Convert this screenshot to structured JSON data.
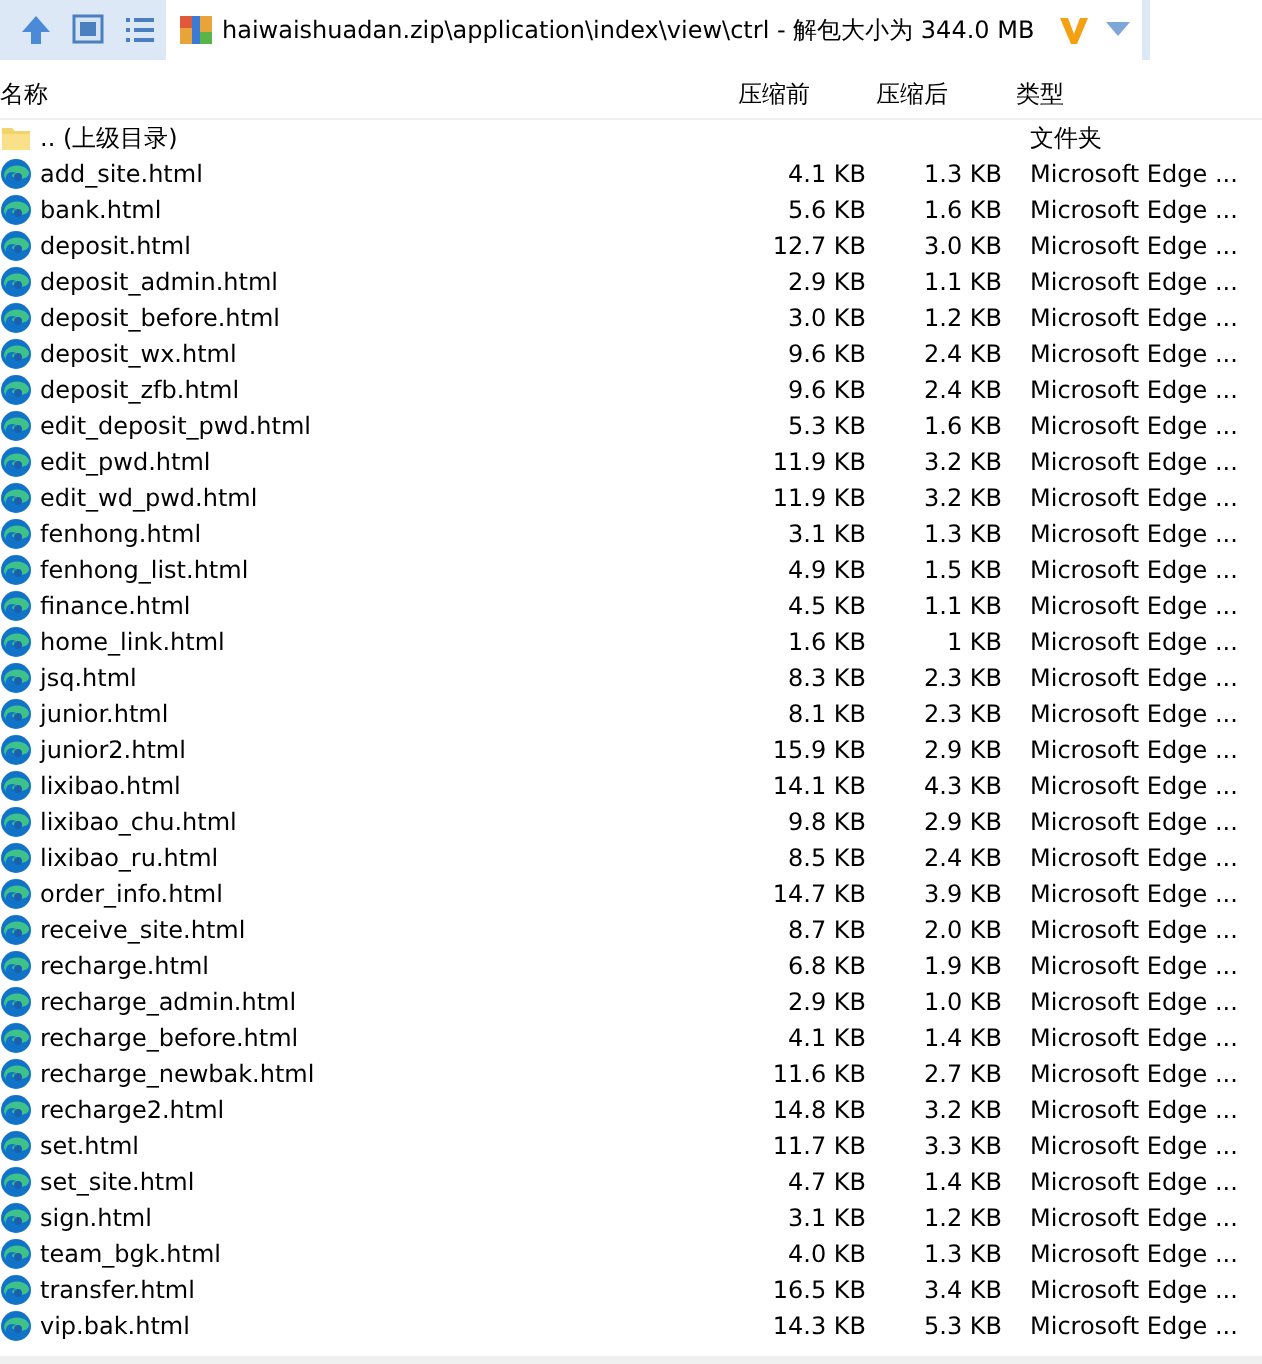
{
  "address_bar": {
    "path": "haiwaishuadan.zip\\application\\index\\view\\ctrl - 解包大小为 344.0 MB"
  },
  "columns": [
    "名称",
    "压缩前",
    "压缩后",
    "类型"
  ],
  "rows": [
    {
      "kind": "folder",
      "name": ".. (上级目录)",
      "size": "",
      "packed": "",
      "type": "文件夹"
    },
    {
      "kind": "file",
      "name": "add_site.html",
      "size": "4.1 KB",
      "packed": "1.3 KB",
      "type": "Microsoft Edge ..."
    },
    {
      "kind": "file",
      "name": "bank.html",
      "size": "5.6 KB",
      "packed": "1.6 KB",
      "type": "Microsoft Edge ..."
    },
    {
      "kind": "file",
      "name": "deposit.html",
      "size": "12.7 KB",
      "packed": "3.0 KB",
      "type": "Microsoft Edge ..."
    },
    {
      "kind": "file",
      "name": "deposit_admin.html",
      "size": "2.9 KB",
      "packed": "1.1 KB",
      "type": "Microsoft Edge ..."
    },
    {
      "kind": "file",
      "name": "deposit_before.html",
      "size": "3.0 KB",
      "packed": "1.2 KB",
      "type": "Microsoft Edge ..."
    },
    {
      "kind": "file",
      "name": "deposit_wx.html",
      "size": "9.6 KB",
      "packed": "2.4 KB",
      "type": "Microsoft Edge ..."
    },
    {
      "kind": "file",
      "name": "deposit_zfb.html",
      "size": "9.6 KB",
      "packed": "2.4 KB",
      "type": "Microsoft Edge ..."
    },
    {
      "kind": "file",
      "name": "edit_deposit_pwd.html",
      "size": "5.3 KB",
      "packed": "1.6 KB",
      "type": "Microsoft Edge ..."
    },
    {
      "kind": "file",
      "name": "edit_pwd.html",
      "size": "11.9 KB",
      "packed": "3.2 KB",
      "type": "Microsoft Edge ..."
    },
    {
      "kind": "file",
      "name": "edit_wd_pwd.html",
      "size": "11.9 KB",
      "packed": "3.2 KB",
      "type": "Microsoft Edge ..."
    },
    {
      "kind": "file",
      "name": "fenhong.html",
      "size": "3.1 KB",
      "packed": "1.3 KB",
      "type": "Microsoft Edge ..."
    },
    {
      "kind": "file",
      "name": "fenhong_list.html",
      "size": "4.9 KB",
      "packed": "1.5 KB",
      "type": "Microsoft Edge ..."
    },
    {
      "kind": "file",
      "name": "finance.html",
      "size": "4.5 KB",
      "packed": "1.1 KB",
      "type": "Microsoft Edge ..."
    },
    {
      "kind": "file",
      "name": "home_link.html",
      "size": "1.6 KB",
      "packed": "1 KB",
      "type": "Microsoft Edge ..."
    },
    {
      "kind": "file",
      "name": "jsq.html",
      "size": "8.3 KB",
      "packed": "2.3 KB",
      "type": "Microsoft Edge ..."
    },
    {
      "kind": "file",
      "name": "junior.html",
      "size": "8.1 KB",
      "packed": "2.3 KB",
      "type": "Microsoft Edge ..."
    },
    {
      "kind": "file",
      "name": "junior2.html",
      "size": "15.9 KB",
      "packed": "2.9 KB",
      "type": "Microsoft Edge ..."
    },
    {
      "kind": "file",
      "name": "lixibao.html",
      "size": "14.1 KB",
      "packed": "4.3 KB",
      "type": "Microsoft Edge ..."
    },
    {
      "kind": "file",
      "name": "lixibao_chu.html",
      "size": "9.8 KB",
      "packed": "2.9 KB",
      "type": "Microsoft Edge ..."
    },
    {
      "kind": "file",
      "name": "lixibao_ru.html",
      "size": "8.5 KB",
      "packed": "2.4 KB",
      "type": "Microsoft Edge ..."
    },
    {
      "kind": "file",
      "name": "order_info.html",
      "size": "14.7 KB",
      "packed": "3.9 KB",
      "type": "Microsoft Edge ..."
    },
    {
      "kind": "file",
      "name": "receive_site.html",
      "size": "8.7 KB",
      "packed": "2.0 KB",
      "type": "Microsoft Edge ..."
    },
    {
      "kind": "file",
      "name": "recharge.html",
      "size": "6.8 KB",
      "packed": "1.9 KB",
      "type": "Microsoft Edge ..."
    },
    {
      "kind": "file",
      "name": "recharge_admin.html",
      "size": "2.9 KB",
      "packed": "1.0 KB",
      "type": "Microsoft Edge ..."
    },
    {
      "kind": "file",
      "name": "recharge_before.html",
      "size": "4.1 KB",
      "packed": "1.4 KB",
      "type": "Microsoft Edge ..."
    },
    {
      "kind": "file",
      "name": "recharge_newbak.html",
      "size": "11.6 KB",
      "packed": "2.7 KB",
      "type": "Microsoft Edge ..."
    },
    {
      "kind": "file",
      "name": "recharge2.html",
      "size": "14.8 KB",
      "packed": "3.2 KB",
      "type": "Microsoft Edge ..."
    },
    {
      "kind": "file",
      "name": "set.html",
      "size": "11.7 KB",
      "packed": "3.3 KB",
      "type": "Microsoft Edge ..."
    },
    {
      "kind": "file",
      "name": "set_site.html",
      "size": "4.7 KB",
      "packed": "1.4 KB",
      "type": "Microsoft Edge ..."
    },
    {
      "kind": "file",
      "name": "sign.html",
      "size": "3.1 KB",
      "packed": "1.2 KB",
      "type": "Microsoft Edge ..."
    },
    {
      "kind": "file",
      "name": "team_bgk.html",
      "size": "4.0 KB",
      "packed": "1.3 KB",
      "type": "Microsoft Edge ..."
    },
    {
      "kind": "file",
      "name": "transfer.html",
      "size": "16.5 KB",
      "packed": "3.4 KB",
      "type": "Microsoft Edge ..."
    },
    {
      "kind": "file",
      "name": "vip.bak.html",
      "size": "14.3 KB",
      "packed": "5.3 KB",
      "type": "Microsoft Edge ..."
    }
  ]
}
